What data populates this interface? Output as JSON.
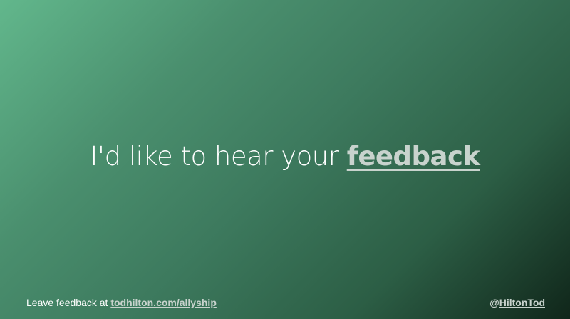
{
  "colors": {
    "gradient_start": "#62b78c",
    "gradient_end": "#10261a",
    "text": "#ffffff",
    "link": "#c8d3cd"
  },
  "headline": {
    "text": "I'd like to hear your ",
    "link_text": "feedback"
  },
  "footer": {
    "left_prefix": "Leave feedback at ",
    "left_link": "todhilton.com/allyship",
    "right_at": "@",
    "right_handle": "HiltonTod"
  }
}
